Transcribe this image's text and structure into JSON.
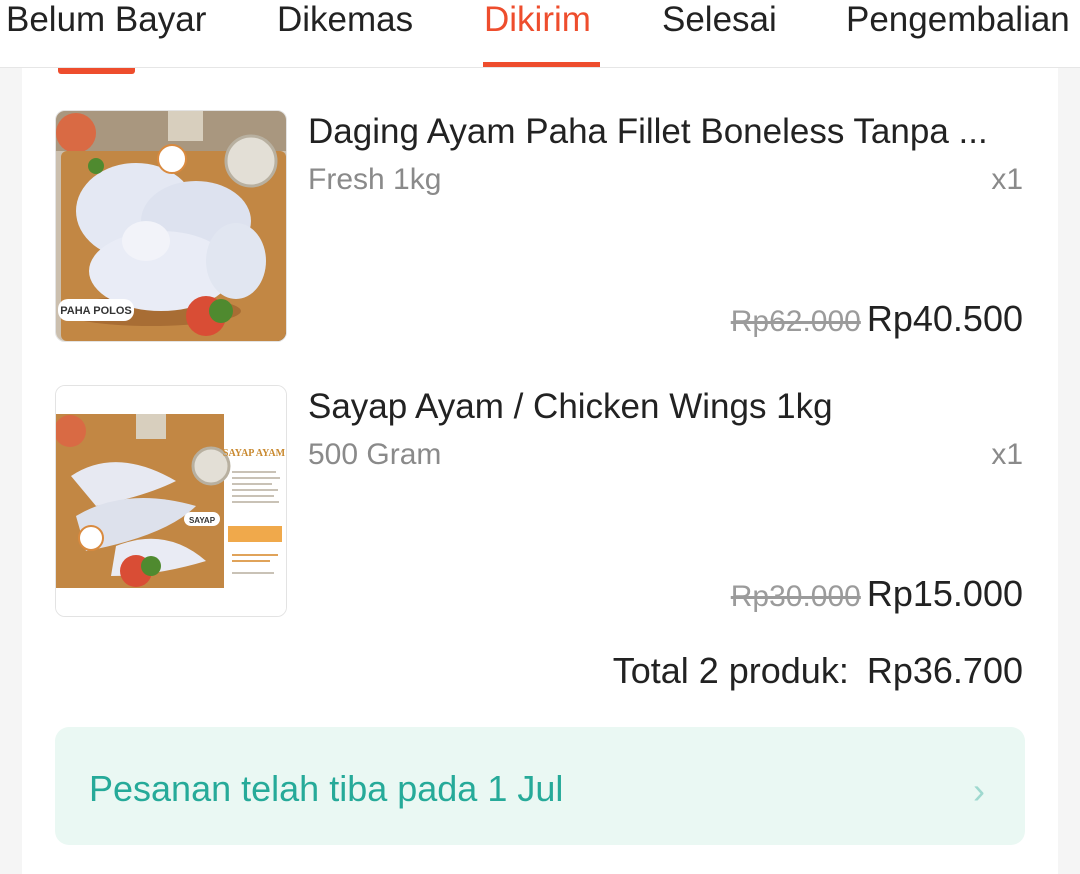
{
  "tabs": [
    {
      "label": "Belum Bayar",
      "active": false
    },
    {
      "label": "Dikemas",
      "active": false
    },
    {
      "label": "Dikirim",
      "active": true
    },
    {
      "label": "Selesai",
      "active": false
    },
    {
      "label": "Pengembalian",
      "active": false
    }
  ],
  "colors": {
    "accent": "#ee4d2d",
    "status_bg": "#eaf8f3",
    "status_text": "#26aa99"
  },
  "products": [
    {
      "name": "Daging Ayam Paha Fillet Boneless Tanpa ...",
      "variant": "Fresh 1kg",
      "qty": "x1",
      "original_price": "Rp62.000",
      "price": "Rp40.500",
      "image_label": "PAHA POLOS"
    },
    {
      "name": "Sayap Ayam / Chicken Wings 1kg",
      "variant": "500 Gram",
      "qty": "x1",
      "original_price": "Rp30.000",
      "price": "Rp15.000",
      "image_label": "SAYAP",
      "image_title": "SAYAP AYAM"
    }
  ],
  "total": {
    "label": "Total 2 produk:",
    "amount": "Rp36.700"
  },
  "status": {
    "text": "Pesanan telah tiba pada 1 Jul",
    "icon": "chevron-right-icon"
  }
}
